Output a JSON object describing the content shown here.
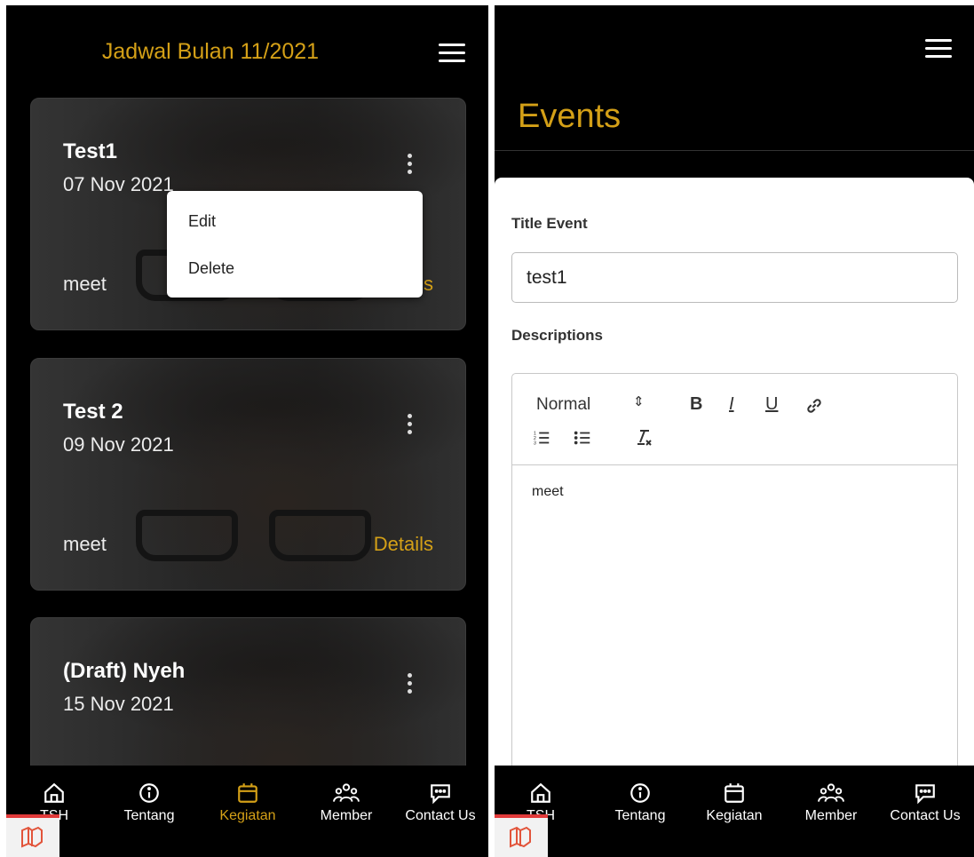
{
  "left": {
    "header_title": "Jadwal Bulan 11/2021",
    "cards": [
      {
        "title": "Test1",
        "date": "07 Nov 2021",
        "description": "meet",
        "details_label": "Details"
      },
      {
        "title": "Test 2",
        "date": "09 Nov 2021",
        "description": "meet",
        "details_label": "Details"
      },
      {
        "title": "(Draft) Nyeh",
        "date": "15 Nov 2021",
        "description": "",
        "details_label": ""
      }
    ],
    "context_menu": {
      "edit": "Edit",
      "delete": "Delete"
    }
  },
  "nav": {
    "items": [
      {
        "label": "TSH",
        "icon": "home-icon"
      },
      {
        "label": "Tentang",
        "icon": "info-icon"
      },
      {
        "label": "Kegiatan",
        "icon": "calendar-icon"
      },
      {
        "label": "Member",
        "icon": "people-icon"
      },
      {
        "label": "Contact Us",
        "icon": "chat-icon"
      }
    ],
    "active_left": "Kegiatan"
  },
  "right": {
    "page_title": "Events",
    "title_label": "Title Event",
    "title_value": "test1",
    "description_label": "Descriptions",
    "editor": {
      "heading_select": "Normal",
      "bold": "B",
      "italic": "I",
      "underline": "U",
      "content": "meet"
    }
  },
  "colors": {
    "accent": "#d4a017",
    "background": "#000000",
    "panel": "#ffffff"
  }
}
